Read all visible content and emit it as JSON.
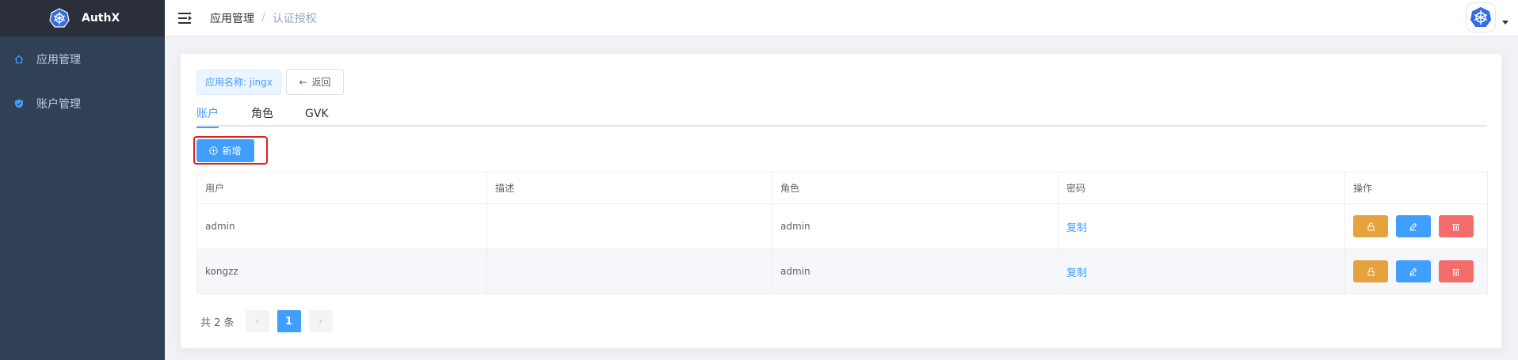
{
  "app": {
    "name": "AuthX",
    "brand_color": "#409eff",
    "sidebar_color": "#304156"
  },
  "sidebar": {
    "items": [
      {
        "label": "应用管理",
        "icon": "home-icon"
      },
      {
        "label": "账户管理",
        "icon": "shield-icon"
      }
    ]
  },
  "breadcrumb": {
    "parent": "应用管理",
    "separator": "/",
    "current": "认证授权"
  },
  "app_tag": "应用名称: jingx",
  "back_label": "返回",
  "tabs": [
    {
      "label": "账户",
      "active": true
    },
    {
      "label": "角色",
      "active": false
    },
    {
      "label": "GVK",
      "active": false
    }
  ],
  "add_label": "新增",
  "table": {
    "headers": [
      "用户",
      "描述",
      "角色",
      "密码",
      "操作"
    ],
    "rows": [
      {
        "user": "admin",
        "desc": "",
        "role": "admin",
        "password": "复制"
      },
      {
        "user": "kongzz",
        "desc": "",
        "role": "admin",
        "password": "复制"
      }
    ]
  },
  "pagination": {
    "total": "共 2 条",
    "current": "1"
  }
}
